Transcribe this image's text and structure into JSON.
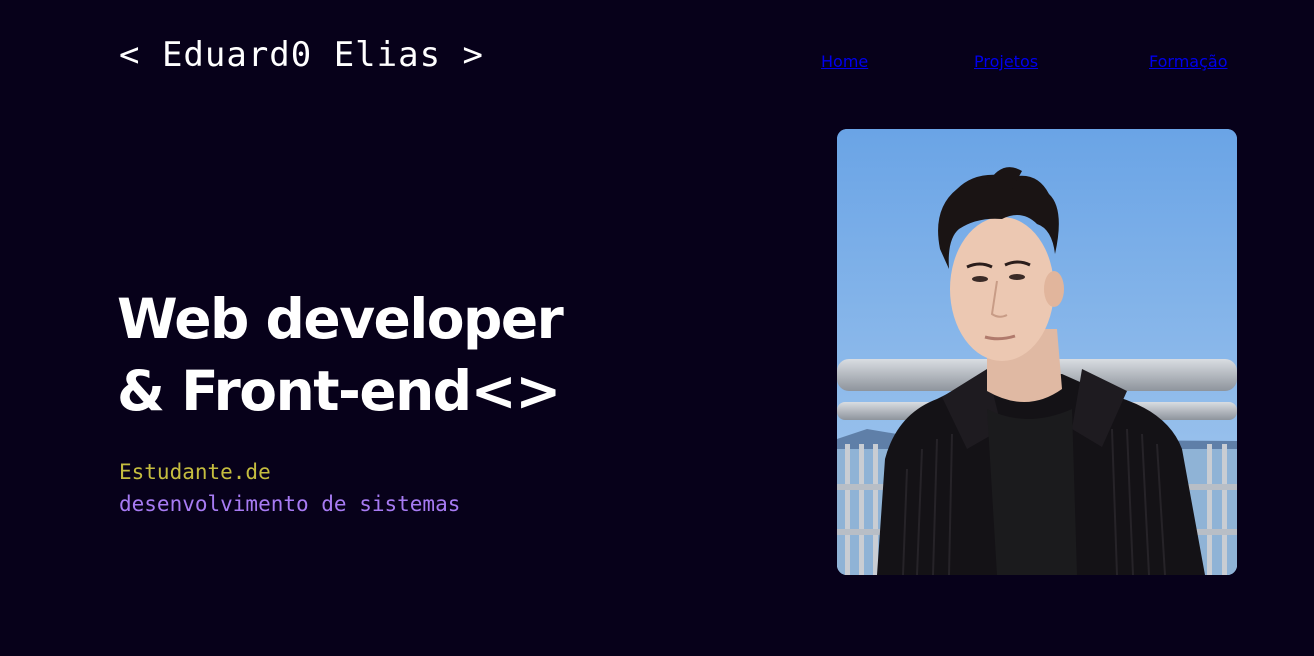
{
  "header": {
    "logo": "< Eduard0 Elias >",
    "nav": {
      "home": "Home",
      "projetos": "Projetos",
      "formacao": "Formação"
    }
  },
  "hero": {
    "headline_line1": "Web developer",
    "headline_line2": "& Front-end<>",
    "subtitle_line1": "Estudante.de",
    "subtitle_line2": "desenvolvimento de sistemas"
  },
  "colors": {
    "background": "#07011a",
    "text": "#ffffff",
    "subtitle_yellow": "#c5bd3f",
    "subtitle_purple": "#a77bf3"
  }
}
